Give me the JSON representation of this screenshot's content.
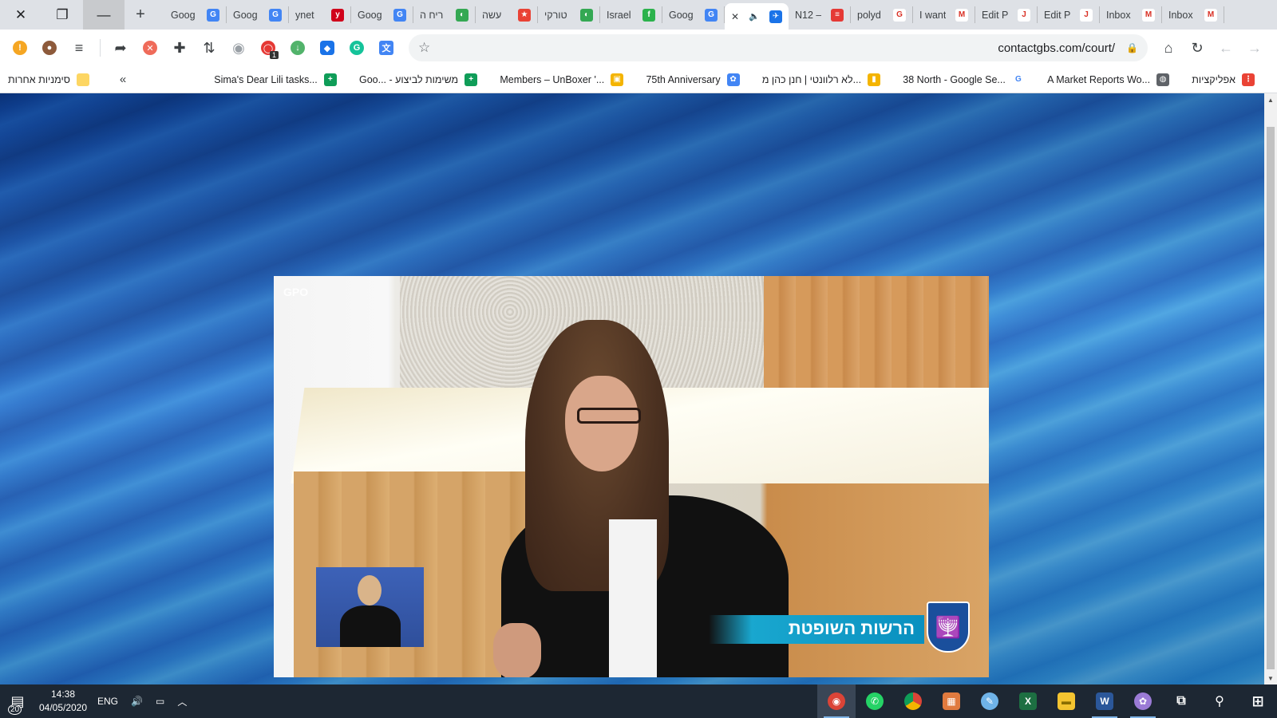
{
  "window": {
    "close_glyph": "✕",
    "restore_glyph": "❐",
    "minimize_glyph": "—",
    "newtab_glyph": "+"
  },
  "tabs": [
    {
      "title": "Goog",
      "icon": "google-translate-icon",
      "color": "#4285f4",
      "glyph": "G"
    },
    {
      "title": "Goog",
      "icon": "google-translate-icon",
      "color": "#4285f4",
      "glyph": "G"
    },
    {
      "title": "ynet",
      "icon": "ynet-icon",
      "color": "#d0021b",
      "glyph": "y"
    },
    {
      "title": "Goog",
      "icon": "google-translate-icon",
      "color": "#4285f4",
      "glyph": "G"
    },
    {
      "title": "ריח ה",
      "icon": "site-icon",
      "color": "#34a853",
      "glyph": "◐"
    },
    {
      "title": "עשה",
      "icon": "site-icon",
      "color": "#e94235",
      "glyph": "★"
    },
    {
      "title": "טורקי",
      "icon": "site-icon",
      "color": "#34a853",
      "glyph": "◐"
    },
    {
      "title": "Israel",
      "icon": "feedly-icon",
      "color": "#2bb24c",
      "glyph": "f"
    },
    {
      "title": "Goog",
      "icon": "google-translate-icon",
      "color": "#4285f4",
      "glyph": "G"
    },
    {
      "title": "",
      "icon": "audio-playing-icon",
      "color": "#1a73e8",
      "glyph": "✈",
      "active": true
    },
    {
      "title": "N12 –",
      "icon": "n12-icon",
      "color": "#e53935",
      "glyph": "≡"
    },
    {
      "title": "polyd",
      "icon": "google-icon",
      "color": "#ffffff",
      "glyph": "G"
    },
    {
      "title": "I want",
      "icon": "gmail-icon",
      "color": "#ffffff",
      "glyph": "M"
    },
    {
      "title": "Edit P",
      "icon": "jetpack-icon",
      "color": "#ffffff",
      "glyph": "J"
    },
    {
      "title": "Edit P",
      "icon": "jetpack-icon",
      "color": "#ffffff",
      "glyph": "J"
    },
    {
      "title": "Inbox",
      "icon": "gmail-icon",
      "color": "#ffffff",
      "glyph": "M"
    },
    {
      "title": "Inbox",
      "icon": "gmail-icon",
      "color": "#ffffff",
      "glyph": "M"
    }
  ],
  "toolbar": {
    "url": "contactgbs.com/court/",
    "badge_count": "1"
  },
  "bookmarks": {
    "other": "סימניות אחרות",
    "more_glyph": "«",
    "items": [
      {
        "label": "Sima's Dear Lili tasks...",
        "icon": "sheets-icon",
        "color": "#0f9d58",
        "glyph": "+"
      },
      {
        "label": "Goo... - משימות לביצוע",
        "icon": "sheets-icon",
        "color": "#0f9d58",
        "glyph": "+"
      },
      {
        "label": "Members – UnBoxer '...",
        "icon": "unboxer-icon",
        "color": "#f4b400",
        "glyph": "▣"
      },
      {
        "label": "75th Anniversary",
        "icon": "site-icon",
        "color": "#4285f4",
        "glyph": "✿"
      },
      {
        "label": "לא רלוונטי | חנן כהן מ...",
        "icon": "slides-icon",
        "color": "#f4b400",
        "glyph": "▮"
      },
      {
        "label": "38 North - Google Se...",
        "icon": "google-icon",
        "color": "#ffffff",
        "glyph": "G"
      },
      {
        "label": "A Market Reports Wo...",
        "icon": "globe-icon",
        "color": "#5f6368",
        "glyph": "◍"
      },
      {
        "label": "אפליקציות",
        "icon": "apps-grid-icon",
        "color": "#ea4335",
        "glyph": "⋮"
      }
    ]
  },
  "video": {
    "caption": "הרשות השופטת",
    "watermark": "GPO"
  },
  "taskbar": {
    "notification_count": "20",
    "time": "14:38",
    "date": "04/05/2020",
    "language": "ENG"
  },
  "colors": {
    "taskbar": "#1d2733",
    "ticker": "#19a7cf",
    "accent": "#1a73e8"
  }
}
